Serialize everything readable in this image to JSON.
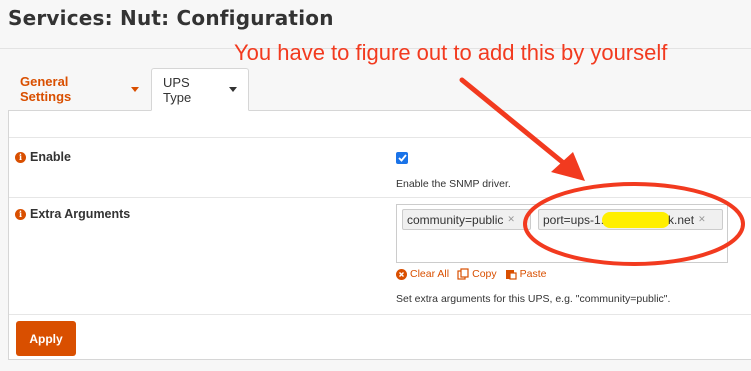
{
  "page": {
    "title": "Services: Nut: Configuration"
  },
  "tabs": [
    {
      "label": "General Settings"
    },
    {
      "label": "UPS Type"
    }
  ],
  "form": {
    "enable": {
      "label": "Enable",
      "checked": true,
      "help": "Enable the SNMP driver."
    },
    "extra_arguments": {
      "label": "Extra Arguments",
      "tokens": [
        {
          "prefix": "community=public",
          "suffix": ""
        },
        {
          "prefix": "port=ups-1.",
          "suffix": "k.net"
        }
      ],
      "actions": {
        "clear_all": "Clear All",
        "copy": "Copy",
        "paste": "Paste"
      },
      "help": "Set extra arguments for this UPS, e.g. \"community=public\"."
    }
  },
  "footer": {
    "apply_label": "Apply"
  },
  "annotation": {
    "text": "You have to figure out to add this by yourself",
    "color": "#f23a1f"
  },
  "colors": {
    "accent": "#d94f00",
    "checkbox": "#1a73e8",
    "highlight": "#ffef00"
  }
}
